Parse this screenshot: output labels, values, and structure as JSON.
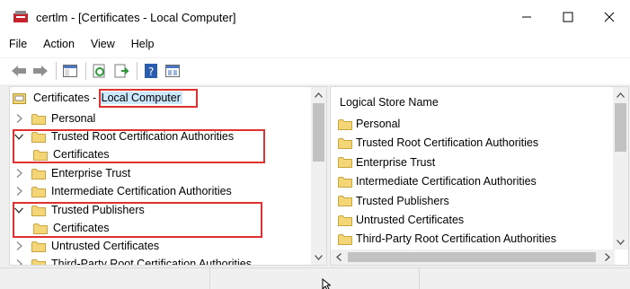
{
  "window": {
    "title": "certlm - [Certificates - Local Computer]",
    "minimize_glyph": "—",
    "maximize_glyph": "☐",
    "close_glyph": "✕"
  },
  "menu": [
    "File",
    "Action",
    "View",
    "Help"
  ],
  "toolbar": {
    "icons": [
      "back-arrow-icon",
      "forward-arrow-icon",
      "show-hide-console-tree-icon",
      "refresh-icon",
      "export-list-icon",
      "help-icon",
      "properties-icon"
    ]
  },
  "tree": {
    "root_prefix": "Certificates",
    "root_separator": " - ",
    "root_suffix": "Local Computer",
    "items": [
      {
        "label": "Personal",
        "expanded": false,
        "level": 1
      },
      {
        "label": "Trusted Root Certification Authorities",
        "expanded": true,
        "level": 1
      },
      {
        "label": "Certificates",
        "expanded": false,
        "level": 2
      },
      {
        "label": "Enterprise Trust",
        "expanded": false,
        "level": 1
      },
      {
        "label": "Intermediate Certification Authorities",
        "expanded": false,
        "level": 1
      },
      {
        "label": "Trusted Publishers",
        "expanded": true,
        "level": 1
      },
      {
        "label": "Certificates",
        "expanded": false,
        "level": 2
      },
      {
        "label": "Untrusted Certificates",
        "expanded": false,
        "level": 1
      },
      {
        "label": "Third-Party Root Certification Authorities",
        "expanded": false,
        "level": 1
      }
    ]
  },
  "list": {
    "column_header": "Logical Store Name",
    "items": [
      "Personal",
      "Trusted Root Certification Authorities",
      "Enterprise Trust",
      "Intermediate Certification Authorities",
      "Trusted Publishers",
      "Untrusted Certificates",
      "Third-Party Root Certification Authorities"
    ]
  },
  "colors": {
    "highlight_border": "#e03030",
    "selection": "#cce8ff",
    "folder": "#f5d676"
  }
}
